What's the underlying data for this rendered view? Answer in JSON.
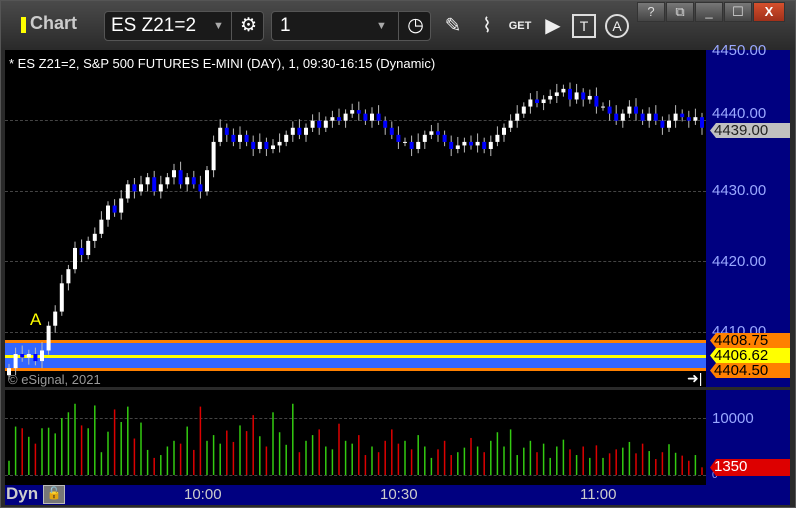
{
  "window": {
    "title": "Chart",
    "help": "?",
    "minimize": "_",
    "close": "X"
  },
  "toolbar": {
    "symbol": "ES Z21=2",
    "interval": "1"
  },
  "chart": {
    "legend": "* ES Z21=2, S&P 500 FUTURES E-MINI (DAY), 1, 09:30-16:15 (Dynamic)",
    "copyright": "© eSignal, 2021",
    "marker": "A",
    "price_ticks": [
      "4450.00",
      "4440.00",
      "4430.00",
      "4420.00",
      "4410.00"
    ],
    "last_price": "4439.00",
    "band": {
      "upper": "4408.75",
      "mid": "4406.62",
      "lower": "4404.50"
    },
    "volume_tick": "10000",
    "volume_zero": "0",
    "last_volume": "1350",
    "time_ticks": [
      "10:00",
      "10:30",
      "11:00"
    ],
    "mode": "Dyn"
  },
  "chart_data": {
    "type": "candlestick",
    "ylim": [
      4400,
      4452
    ],
    "closes": [
      4405,
      4407,
      4406.5,
      4407,
      4406,
      4407.5,
      4411,
      4413,
      4417,
      4419,
      4422,
      4421,
      4423,
      4424,
      4426,
      4428,
      4427,
      4429,
      4431,
      4430,
      4431,
      4432,
      4430,
      4431,
      4432,
      4433,
      4431,
      4432,
      4431,
      4430,
      4433,
      4437,
      4439,
      4438,
      4437,
      4438,
      4437,
      4436,
      4437,
      4436,
      4436.5,
      4437,
      4438,
      4439,
      4438,
      4439,
      4440,
      4439,
      4440,
      4440.5,
      4440,
      4441,
      4441.5,
      4441,
      4440,
      4441,
      4440,
      4439,
      4438,
      4437,
      4437,
      4436,
      4437,
      4438,
      4438.5,
      4438,
      4437,
      4436,
      4436.5,
      4437,
      4436.5,
      4437,
      4436,
      4437,
      4438,
      4439,
      4440,
      4441,
      4442,
      4443,
      4442.5,
      4443,
      4443.5,
      4444,
      4444.5,
      4443,
      4444,
      4443,
      4443.5,
      4442,
      4442,
      4441,
      4440,
      4441,
      4442,
      4441,
      4440,
      4441,
      4440,
      4439,
      4440,
      4441,
      4440.5,
      4440,
      4440.5,
      4439
    ],
    "volumes": [
      2500,
      8500,
      8200,
      6700,
      5500,
      8200,
      8300,
      7300,
      10000,
      11000,
      12500,
      8700,
      8200,
      12200,
      4000,
      7600,
      11500,
      9300,
      12000,
      6400,
      9200,
      4400,
      3000,
      3500,
      5000,
      6000,
      5500,
      8500,
      4400,
      12000,
      6000,
      7000,
      5500,
      7800,
      5800,
      8700,
      7700,
      10500,
      6800,
      5000,
      11000,
      7500,
      5300,
      12500,
      4000,
      6000,
      7000,
      8000,
      5000,
      4500,
      9000,
      6000,
      5500,
      7000,
      3500,
      5000,
      4000,
      6000,
      8000,
      5500,
      6000,
      4500,
      7000,
      5000,
      3000,
      4500,
      6000,
      3500,
      4000,
      4800,
      6500,
      5000,
      4000,
      6000,
      7500,
      5000,
      8000,
      3500,
      4800,
      6000,
      4000,
      5500,
      3000,
      5000,
      6200,
      4500,
      3500,
      5000,
      3000,
      5200,
      3000,
      3800,
      4500,
      4800,
      5800,
      3800,
      5500,
      4200,
      2800,
      4000,
      5400,
      3900,
      3400,
      2500,
      3500,
      1350
    ]
  },
  "colors": {
    "up": "#ffffff",
    "down": "#0000ff",
    "vol_up": "#33cc11",
    "vol_down": "#dd0000",
    "band": "#3366ff",
    "band_edge": "#ff8000",
    "band_mid": "#ffff00",
    "axis": "#000080"
  }
}
